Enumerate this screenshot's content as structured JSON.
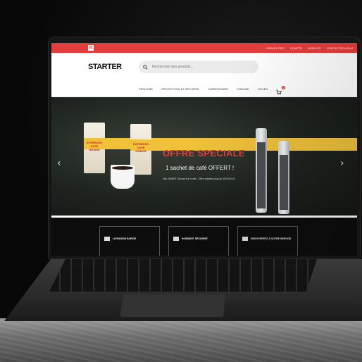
{
  "topbar": {
    "links": [
      "ESPACE PRO",
      "COMPTE",
      "WISHLIST",
      "CONTACTEZ-NOUS"
    ]
  },
  "header": {
    "logo": "STARTER",
    "search_placeholder": "Rechercher des produits..."
  },
  "nav": {
    "items": [
      "PEINTURE",
      "PROTECTION ET SÉCURITÉ",
      "CARROSSERIE",
      "VITRAGE",
      "VOLIER"
    ],
    "cart_count": "0"
  },
  "hero": {
    "title": "OFFRE SPECIALE",
    "subtitle": "1 sachet de café OFFERT !",
    "note": "Dès 100€HT d'achat sur le site - Offre valable jusqu'au 30/04/2023",
    "bag_text": "EXPRESSO CAFE GRAINS",
    "slide_count": 7,
    "active_slide": 0
  },
  "features": [
    "LIVRAISON RAPIDE",
    "PAIEMENT SÉCURISÉ",
    "DES EXPERTS À VOTRE SERVICE"
  ],
  "colors": {
    "brand_red": "#e43d3d"
  }
}
